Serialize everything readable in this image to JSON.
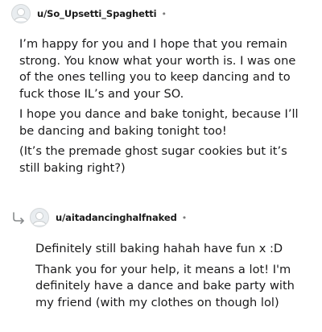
{
  "comments": [
    {
      "username": "u/So_Upsetti_Spaghetti",
      "separator": "•",
      "avatar_icon": "user-avatar-icon",
      "paragraphs": [
        "I’m happy for you and I hope that you remain strong. You know what your worth is. I was one of the ones telling you to keep dancing and to fuck those IL’s and your SO.",
        "I hope you dance and bake tonight, because I’ll be dancing and baking tonight too!",
        "(It’s the premade ghost sugar cookies but it’s still baking right?)"
      ]
    },
    {
      "username": "u/aitadancinghalfnaked",
      "separator": "•",
      "avatar_icon": "user-avatar-icon",
      "reply_icon": "reply-arrow-icon",
      "paragraphs": [
        "Definitely still baking hahah have fun x :D",
        "Thank you for your help, it means a lot! I'm definitely have a dance and bake party with my friend (with my clothes on though lol)"
      ]
    }
  ]
}
